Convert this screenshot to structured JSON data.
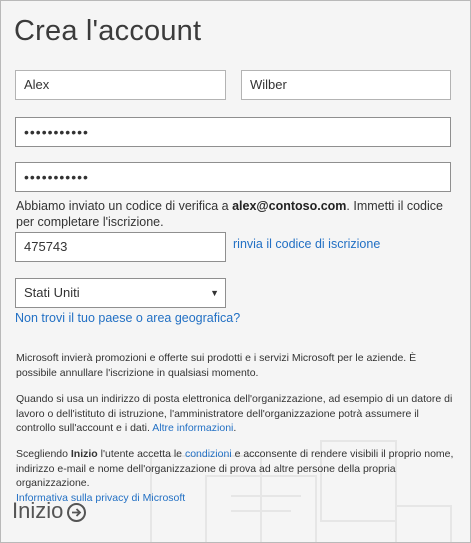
{
  "title": "Crea l'account",
  "first_name": "Alex",
  "last_name": "Wilber",
  "password": "•••••••••••",
  "confirm_password": "•••••••••••",
  "verification": {
    "prefix": "Abbiamo inviato un codice di verifica a ",
    "email": "alex@contoso.com",
    "suffix": ". Immetti il codice per completare l'iscrizione."
  },
  "code_value": "475743",
  "resend_link": "rinvia il codice di iscrizione",
  "country": {
    "selected": "Stati Uniti",
    "link": "Non trovi il tuo paese o area geografica?"
  },
  "notice1": "Microsoft invierà promozioni e offerte sui prodotti e i servizi Microsoft per le aziende. È possibile annullare l'iscrizione in qualsiasi momento.",
  "notice2": {
    "text": "Quando si usa un indirizzo di posta elettronica dell'organizzazione, ad esempio di un datore di lavoro o dell'istituto di istruzione, l'amministratore dell'organizzazione potrà assumere il controllo sull'account e i dati. ",
    "link": "Altre informazioni",
    "end": "."
  },
  "notice3": {
    "part1": "Scegliendo ",
    "bold": "Inizio",
    "part2": " l'utente accetta le ",
    "link1": "condizioni",
    "part3": " e acconsente di rendere visibili il proprio nome, indirizzo e-mail e nome dell'organizzazione di prova ad altre persone della propria organizzazione.",
    "link2": "Informativa sulla privacy di Microsoft"
  },
  "start_label": "Inizio",
  "colors": {
    "link": "#2270c4",
    "background": "#f5f5f5"
  },
  "icons": {
    "start": "arrow-right-circle-icon",
    "select": "chevron-down-icon"
  }
}
